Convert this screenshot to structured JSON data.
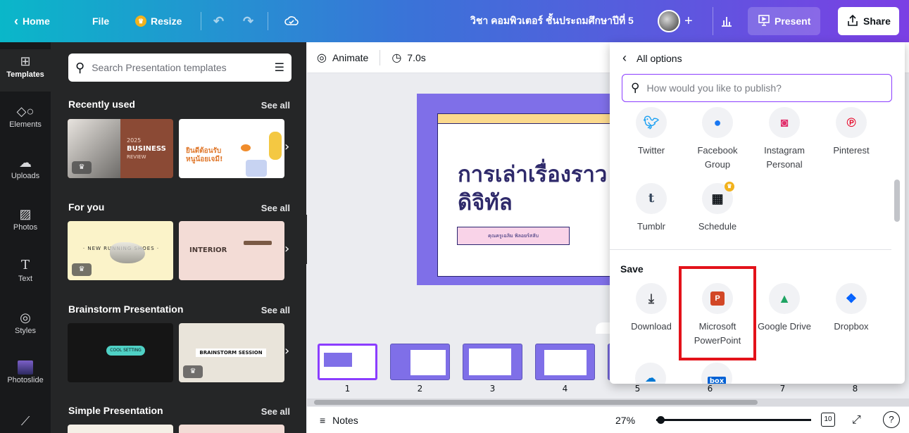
{
  "topbar": {
    "home_label": "Home",
    "file_label": "File",
    "resize_label": "Resize",
    "doc_title": "วิชา คอมพิวเตอร์ ชั้นประถมศึกษาปีที่ 5",
    "present_label": "Present",
    "share_label": "Share"
  },
  "rail": {
    "items": [
      {
        "label": "Templates",
        "icon": "templates-icon"
      },
      {
        "label": "Elements",
        "icon": "elements-icon"
      },
      {
        "label": "Uploads",
        "icon": "uploads-icon"
      },
      {
        "label": "Photos",
        "icon": "photos-icon"
      },
      {
        "label": "Text",
        "icon": "text-icon"
      },
      {
        "label": "Styles",
        "icon": "styles-icon"
      },
      {
        "label": "Photoslide",
        "icon": "photoslide-icon"
      }
    ]
  },
  "panel": {
    "search_placeholder": "Search Presentation templates",
    "see_all": "See all",
    "sections": [
      {
        "title": "Recently used"
      },
      {
        "title": "For you"
      },
      {
        "title": "Brainstorm Presentation"
      },
      {
        "title": "Simple Presentation"
      }
    ],
    "thumb_texts": {
      "business_year": "2025",
      "business_title": "BUSINESS",
      "business_sub": "REVIEW",
      "welcome_line1": "ยินดีต้อนรับ",
      "welcome_line2": "หนูน้อยเจมี!",
      "running": "· NEW RUNNING SHOES ·",
      "interior": "INTERIOR",
      "cool_setting": "COOL SETTING",
      "brainstorm_session": "BRAINSTORM SESSION"
    }
  },
  "editor": {
    "animate_label": "Animate",
    "duration": "7.0s",
    "slide_title_line1": "การเล่าเรื่องราว",
    "slide_title_line2": "ดิจิทัล",
    "slide_subtitle": "คุณครูเฉลิม พิลอยร์สลับ",
    "notes_label": "Notes",
    "zoom": "27%",
    "page_count": "10",
    "help": "?",
    "pages": [
      "1",
      "2",
      "3",
      "4",
      "5",
      "6",
      "7",
      "8"
    ]
  },
  "share_popup": {
    "back_label": "All options",
    "search_placeholder": "How would you like to publish?",
    "social": [
      {
        "label": "Twitter",
        "icon": "twitter-icon",
        "color": "#1da1f2"
      },
      {
        "label": "Facebook Group",
        "icon": "facebook-group-icon",
        "color": "#1877f2"
      },
      {
        "label": "Instagram Personal",
        "icon": "instagram-icon",
        "color": "#e1306c"
      },
      {
        "label": "Pinterest",
        "icon": "pinterest-icon",
        "color": "#e60023"
      },
      {
        "label": "Tumblr",
        "icon": "tumblr-icon",
        "color": "#35465c"
      },
      {
        "label": "Schedule",
        "icon": "schedule-icon",
        "color": "#0e1318"
      }
    ],
    "save_heading": "Save",
    "save": [
      {
        "label": "Download",
        "icon": "download-icon",
        "color": "#0e1318"
      },
      {
        "label": "Microsoft PowerPoint",
        "icon": "powerpoint-icon",
        "color": "#d24726"
      },
      {
        "label": "Google Drive",
        "icon": "google-drive-icon",
        "color": "#1fa463"
      },
      {
        "label": "Dropbox",
        "icon": "dropbox-icon",
        "color": "#0061ff"
      }
    ],
    "box_label": "box"
  },
  "colors": {
    "accent": "#7d2ae8",
    "highlight": "#e3121a",
    "slide_bg": "#7f6fe8"
  }
}
